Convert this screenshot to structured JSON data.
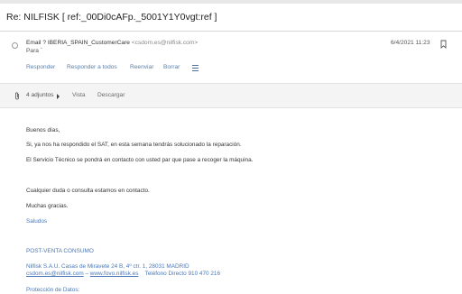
{
  "subject": "Re: NILFISK [ ref:_00Di0cAFp._5001Y1Y0vgt:ref ]",
  "message": {
    "from_name": "Email ? IBERIA_SPAIN_CustomerCare",
    "from_address": "<csdom.es@nilfisk.com>",
    "to_label": "Para",
    "to_value": "ˉ",
    "date": "6/4/2021 11:23",
    "actions": {
      "reply": "Responder",
      "reply_all": "Responder a todos",
      "forward": "Reenviar",
      "delete": "Borrar"
    }
  },
  "attachments": {
    "count_label": "4 adjuntos",
    "view": "Vista",
    "download": "Descargar"
  },
  "body": {
    "greeting": "Buenos días,",
    "p1": "Si, ya nos ha respondido el SAT, en esta semana tendrás solucionado la reparación.",
    "p2": "El Servicio Técnico se pondrá en contacto con usted par que pase a recoger la máquina.",
    "p3": "Cualquier duda o consulta estamos en contacto.",
    "thanks": "Muchas gracias.",
    "sign": "Saludos",
    "dept": "POST-VENTA CONSUMO",
    "company_line": "Nilfisk S.A.U. Casas de Miravete 24 B, 4º ctr. 1, 28031 MADRID",
    "email_link": "csdom.es@nilfisk.com",
    "sep": " – ",
    "web_link": "www.fovo.nilfisk.es",
    "phone": "Teléfono Directo 910 470 216",
    "data_protection": "Protección de Datos:"
  },
  "colors": {
    "link": "#4a78b8",
    "action": "#5b7fa8"
  }
}
